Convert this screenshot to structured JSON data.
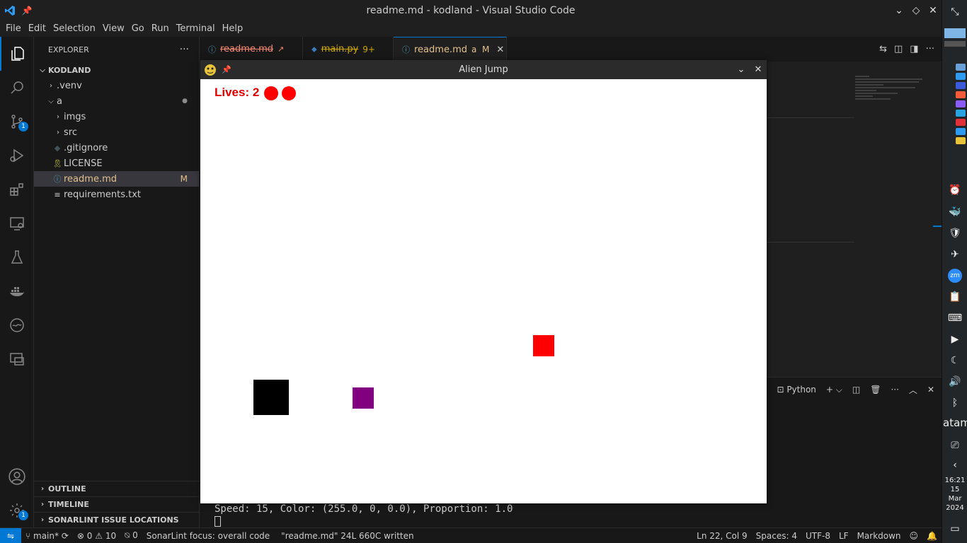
{
  "window": {
    "title": "readme.md - kodland - Visual Studio Code"
  },
  "menu": [
    "File",
    "Edit",
    "Selection",
    "View",
    "Go",
    "Run",
    "Terminal",
    "Help"
  ],
  "sidebar": {
    "title": "EXPLORER",
    "root": "KODLAND",
    "tree": [
      {
        "label": ".venv",
        "kind": "folder-collapsed",
        "depth": 1
      },
      {
        "label": "a",
        "kind": "folder-open",
        "depth": 1,
        "deco": "●"
      },
      {
        "label": "imgs",
        "kind": "folder-collapsed",
        "depth": 2
      },
      {
        "label": "src",
        "kind": "folder-collapsed",
        "depth": 2
      },
      {
        "label": ".gitignore",
        "kind": "file",
        "depth": 2,
        "icon": "◆"
      },
      {
        "label": "LICENSE",
        "kind": "file",
        "depth": 2,
        "icon": "🎗"
      },
      {
        "label": "readme.md",
        "kind": "file",
        "depth": 2,
        "icon": "ⓘ",
        "deco": "M",
        "selected": true
      },
      {
        "label": "requirements.txt",
        "kind": "file",
        "depth": 2,
        "icon": "≡"
      }
    ],
    "panels": [
      "OUTLINE",
      "TIMELINE",
      "SONARLINT ISSUE LOCATIONS"
    ]
  },
  "activity_badges": {
    "source_control": "1",
    "settings": "1"
  },
  "tabs": [
    {
      "label": "readme.md",
      "suffix": "↗",
      "icon": "ⓘ"
    },
    {
      "label": "main.py",
      "suffix": "9+",
      "icon": "⬥"
    },
    {
      "label": "readme.md",
      "suffix": "a  M",
      "icon": "ⓘ",
      "active": true
    }
  ],
  "terminal": {
    "profile": "Python",
    "output": "Speed: 15, Color: (255.0, 0, 0.0), Proportion: 1.0"
  },
  "game": {
    "title": "Alien Jump",
    "lives_label": "Lives: 2",
    "lives": 2,
    "colors": {
      "heart": "#ff0000",
      "player": "#000000",
      "enemy_red": "#ff0000",
      "enemy_purple": "#800080"
    }
  },
  "statusbar": {
    "branch": "main*",
    "errors": "0",
    "warnings": "10",
    "ports": "0",
    "sonarlint": "SonarLint focus: overall code",
    "message": "\"readme.md\" 24L 660C written",
    "position": "Ln 22, Col 9",
    "spaces": "Spaces: 4",
    "encoding": "UTF-8",
    "eol": "LF",
    "language": "Markdown"
  },
  "taskbar": {
    "clock_time": "16:21",
    "clock_day": "15",
    "clock_month": "Mar",
    "clock_year": "2024",
    "label": "atam"
  }
}
